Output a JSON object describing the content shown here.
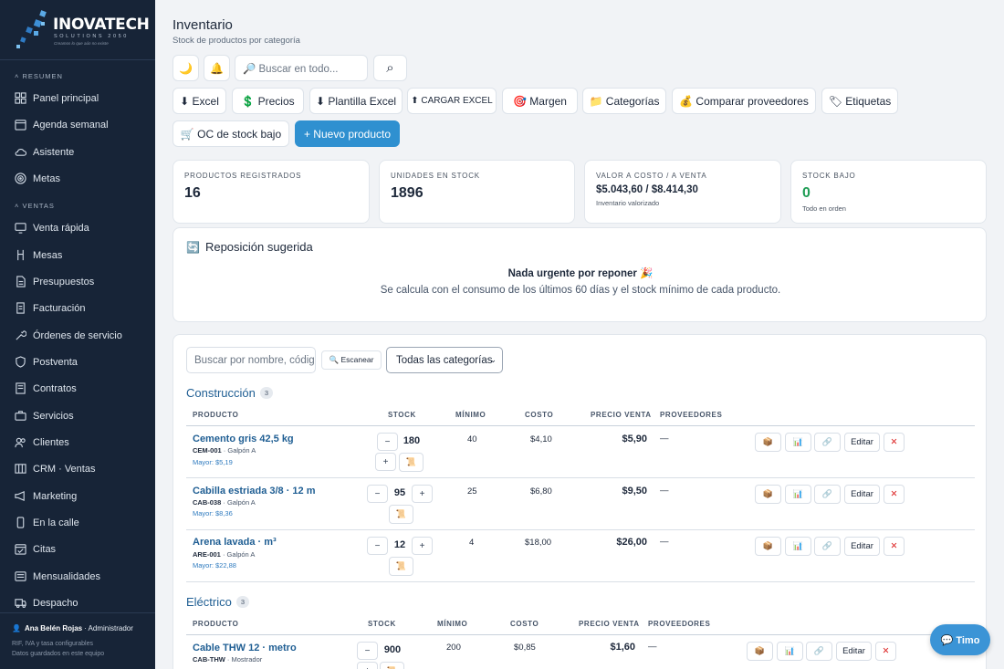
{
  "brand": {
    "name": "INOVATECH",
    "sub": "SOLUTIONS 2050",
    "tagline": "Creamos lo que aún no existe"
  },
  "sidebar": {
    "sections": [
      "RESUMEN",
      "VENTAS"
    ],
    "items": [
      {
        "label": "Panel principal",
        "icon": "dashboard-icon"
      },
      {
        "label": "Agenda semanal",
        "icon": "calendar-icon"
      },
      {
        "label": "Asistente",
        "icon": "cloud-icon"
      },
      {
        "label": "Metas",
        "icon": "target-icon"
      },
      {
        "label": "Venta rápida",
        "icon": "monitor-icon"
      },
      {
        "label": "Mesas",
        "icon": "chair-icon"
      },
      {
        "label": "Presupuestos",
        "icon": "document-icon"
      },
      {
        "label": "Facturación",
        "icon": "receipt-icon"
      },
      {
        "label": "Órdenes de servicio",
        "icon": "wrench-icon"
      },
      {
        "label": "Postventa",
        "icon": "shield-icon"
      },
      {
        "label": "Contratos",
        "icon": "contract-icon"
      },
      {
        "label": "Servicios",
        "icon": "briefcase-icon"
      },
      {
        "label": "Clientes",
        "icon": "users-icon"
      },
      {
        "label": "CRM · Ventas",
        "icon": "kanban-icon"
      },
      {
        "label": "Marketing",
        "icon": "megaphone-icon"
      },
      {
        "label": "En la calle",
        "icon": "phone-icon"
      },
      {
        "label": "Citas",
        "icon": "calendar-check-icon"
      },
      {
        "label": "Mensualidades",
        "icon": "list-icon"
      },
      {
        "label": "Despacho",
        "icon": "truck-icon"
      }
    ],
    "user_name": "Ana Belén Rojas",
    "user_role": "· Administrador",
    "footer_line1": "RIF, IVA y tasa configurables",
    "footer_line2": "Datos guardados en este equipo"
  },
  "header": {
    "title": "Inventario",
    "subtitle": "Stock de productos por categoría",
    "theme_icon": "🌙",
    "bell_icon": "🔔",
    "search_placeholder": "🔎 Buscar en todo...",
    "search_icon": "⌕"
  },
  "toolbar": {
    "excel": "⬇ Excel",
    "precios": "💲 Precios",
    "plantilla": "⬇ Plantilla Excel",
    "cargar": "⬆ CARGAR EXCEL",
    "margen": "🎯 Margen",
    "categorias": "📁 Categorías",
    "comparar": "💰 Comparar proveedores",
    "etiquetas": "🏷 Etiquetas",
    "oc": "🛒 OC de stock bajo",
    "nuevo": "+ Nuevo producto"
  },
  "kpis": {
    "registrados_label": "PRODUCTOS REGISTRADOS",
    "registrados_value": "16",
    "unidades_label": "UNIDADES EN STOCK",
    "unidades_value": "1896",
    "valor_label": "VALOR A COSTO / A VENTA",
    "valor_value": "$5.043,60 / $8.414,30",
    "valor_sub": "Inventario valorizado",
    "bajo_label": "STOCK BAJO",
    "bajo_value": "0",
    "bajo_sub": "Todo en orden",
    "bajo_color": "#1f9d55"
  },
  "reposicion": {
    "icon": "🔄",
    "title": "Reposición sugerida",
    "headline": "Nada urgente por reponer 🎉",
    "detail": "Se calcula con el consumo de los últimos 60 días y el stock mínimo de cada producto."
  },
  "filters": {
    "search_placeholder": "Buscar por nombre, código",
    "scan": "🔍 Escanear",
    "category": "Todas las categorías"
  },
  "table_headers": [
    "PRODUCTO",
    "STOCK",
    "MÍNIMO",
    "COSTO",
    "PRECIO VENTA",
    "PROVEEDORES"
  ],
  "categories": [
    {
      "name": "Construcción",
      "count": "3",
      "products": [
        {
          "name": "Cemento gris 42,5 kg",
          "code": "CEM-001",
          "location": "· Galpón A",
          "mayor": "Mayor: $5,19",
          "stock": "180",
          "min": "40",
          "cost": "$4,10",
          "price": "$5,90",
          "prov": "—"
        },
        {
          "name": "Cabilla estriada 3/8 · 12 m",
          "code": "CAB-038",
          "location": "· Galpón A",
          "mayor": "Mayor: $8,36",
          "stock": "95",
          "min": "25",
          "cost": "$6,80",
          "price": "$9,50",
          "prov": "—"
        },
        {
          "name": "Arena lavada · m³",
          "code": "ARE-001",
          "location": "· Galpón A",
          "mayor": "Mayor: $22,88",
          "stock": "12",
          "min": "4",
          "cost": "$18,00",
          "price": "$26,00",
          "prov": "—"
        }
      ]
    },
    {
      "name": "Eléctrico",
      "count": "3",
      "products": [
        {
          "name": "Cable THW 12 · metro",
          "code": "CAB-THW",
          "location": "· Mostrador",
          "stock": "900",
          "min": "200",
          "cost": "$0,85",
          "price": "$1,60",
          "prov": "—"
        }
      ]
    }
  ],
  "row_actions": {
    "box": "📦",
    "chart": "📊",
    "link": "🔗",
    "edit": "Editar",
    "delete": "✕",
    "minus": "−",
    "plus": "+",
    "note": "📜"
  },
  "assistant": {
    "label": "💬 Timo"
  }
}
